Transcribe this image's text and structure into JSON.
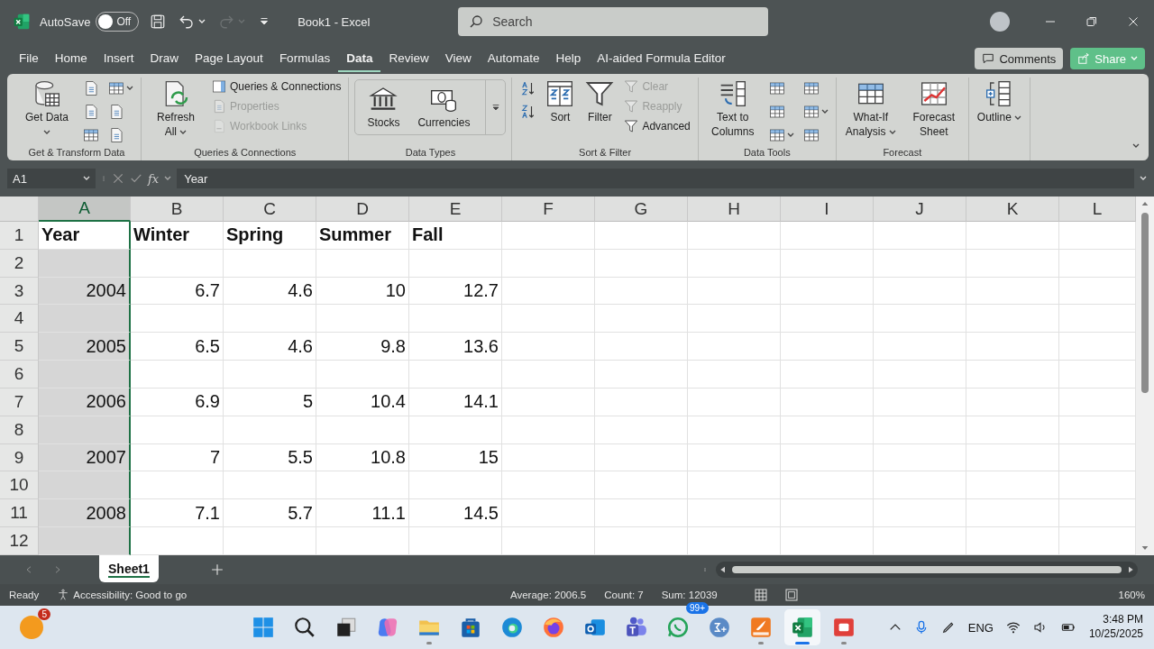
{
  "title_bar": {
    "autosave": {
      "label": "AutoSave",
      "state": "Off",
      "on": false
    },
    "document_title": "Book1  -  Excel",
    "search": {
      "placeholder": "Search"
    }
  },
  "menu_tabs": [
    {
      "label": "File",
      "selected": false
    },
    {
      "label": "Home",
      "selected": false
    },
    {
      "label": "Insert",
      "selected": false
    },
    {
      "label": "Draw",
      "selected": false
    },
    {
      "label": "Page Layout",
      "selected": false
    },
    {
      "label": "Formulas",
      "selected": false
    },
    {
      "label": "Data",
      "selected": true
    },
    {
      "label": "Review",
      "selected": false
    },
    {
      "label": "View",
      "selected": false
    },
    {
      "label": "Automate",
      "selected": false
    },
    {
      "label": "Help",
      "selected": false
    },
    {
      "label": "AI-aided Formula Editor",
      "selected": false
    }
  ],
  "comments_button": "Comments",
  "share_button": "Share",
  "ribbon": {
    "groups": [
      {
        "label": "Get & Transform Data",
        "columns": [
          {
            "kind": "stack",
            "items": [
              {
                "kind": "large",
                "label": "Get Data",
                "menu": true,
                "disabled": false
              }
            ]
          },
          {
            "kind": "stack",
            "items": [
              {
                "kind": "icon",
                "menu": false,
                "disabled": false
              },
              {
                "kind": "icon",
                "menu": false,
                "disabled": false
              },
              {
                "kind": "icon",
                "menu": false,
                "disabled": false
              }
            ]
          },
          {
            "kind": "stack",
            "items": [
              {
                "kind": "icon",
                "menu": true,
                "disabled": false
              },
              {
                "kind": "icon",
                "menu": false,
                "disabled": false
              },
              {
                "kind": "icon",
                "menu": false,
                "disabled": false
              }
            ]
          }
        ]
      },
      {
        "label": "Queries & Connections",
        "columns": [
          {
            "kind": "stack",
            "items": [
              {
                "kind": "large",
                "label": "Refresh All",
                "menu": true,
                "disabled": false
              }
            ]
          },
          {
            "kind": "stack",
            "items": [
              {
                "kind": "small",
                "label": "Queries & Connections",
                "menu": false,
                "disabled": false
              },
              {
                "kind": "small",
                "label": "Properties",
                "menu": false,
                "disabled": true
              },
              {
                "kind": "small",
                "label": "Workbook Links",
                "menu": false,
                "disabled": true
              }
            ]
          }
        ]
      },
      {
        "label": "Data Types",
        "columns": [
          {
            "kind": "gallery",
            "items": [
              {
                "kind": "large",
                "label": "Stocks",
                "menu": false,
                "disabled": false
              },
              {
                "kind": "large",
                "label": "Currencies",
                "menu": false,
                "disabled": false
              }
            ]
          }
        ]
      },
      {
        "label": "Sort & Filter",
        "columns": [
          {
            "kind": "stack",
            "items": [
              {
                "kind": "icon",
                "menu": false,
                "disabled": false
              },
              {
                "kind": "icon",
                "menu": false,
                "disabled": false
              }
            ]
          },
          {
            "kind": "stack",
            "items": [
              {
                "kind": "large",
                "label": "Sort",
                "menu": false,
                "disabled": false
              }
            ]
          },
          {
            "kind": "stack",
            "items": [
              {
                "kind": "large",
                "label": "Filter",
                "menu": false,
                "disabled": false
              }
            ]
          },
          {
            "kind": "stack",
            "items": [
              {
                "kind": "small",
                "label": "Clear",
                "menu": false,
                "disabled": true
              },
              {
                "kind": "small",
                "label": "Reapply",
                "menu": false,
                "disabled": true
              },
              {
                "kind": "small",
                "label": "Advanced",
                "menu": false,
                "disabled": false
              }
            ]
          }
        ]
      },
      {
        "label": "Data Tools",
        "columns": [
          {
            "kind": "stack",
            "items": [
              {
                "kind": "large",
                "label": "Text to Columns",
                "menu": false,
                "disabled": false
              }
            ]
          },
          {
            "kind": "stack",
            "items": [
              {
                "kind": "icon",
                "menu": false,
                "disabled": false
              },
              {
                "kind": "icon",
                "menu": false,
                "disabled": false
              },
              {
                "kind": "icon",
                "menu": true,
                "disabled": false
              }
            ]
          },
          {
            "kind": "stack",
            "items": [
              {
                "kind": "icon",
                "menu": false,
                "disabled": false
              },
              {
                "kind": "icon",
                "menu": true,
                "disabled": false
              },
              {
                "kind": "icon",
                "menu": false,
                "disabled": false
              }
            ]
          }
        ]
      },
      {
        "label": "Forecast",
        "columns": [
          {
            "kind": "stack",
            "items": [
              {
                "kind": "large",
                "label": "What-If Analysis",
                "menu": true,
                "disabled": false
              }
            ]
          },
          {
            "kind": "stack",
            "items": [
              {
                "kind": "large",
                "label": "Forecast Sheet",
                "menu": false,
                "disabled": false
              }
            ]
          }
        ]
      },
      {
        "columns": [
          {
            "kind": "stack",
            "items": [
              {
                "kind": "large",
                "label": "Outline",
                "menu": true,
                "disabled": false
              }
            ]
          }
        ]
      }
    ]
  },
  "formula_bar": {
    "name_box": "A1",
    "fx": "fx",
    "value": "Year"
  },
  "sheet": {
    "columns": [
      {
        "label": "A",
        "selected": true
      },
      {
        "label": "B",
        "selected": false
      },
      {
        "label": "C",
        "selected": false
      },
      {
        "label": "D",
        "selected": false
      },
      {
        "label": "E",
        "selected": false
      },
      {
        "label": "F",
        "selected": false
      },
      {
        "label": "G",
        "selected": false
      },
      {
        "label": "H",
        "selected": false
      },
      {
        "label": "I",
        "selected": false
      },
      {
        "label": "J",
        "selected": false
      },
      {
        "label": "K",
        "selected": false
      },
      {
        "label": "L",
        "selected": false
      }
    ],
    "rows": [
      {
        "number": "1",
        "kind": "header",
        "cells": [
          {
            "text": "Year",
            "active": true
          },
          {
            "text": "Winter",
            "active": false
          },
          {
            "text": "Spring",
            "active": false
          },
          {
            "text": "Summer",
            "active": false
          },
          {
            "text": "Fall",
            "active": false
          }
        ]
      },
      {
        "number": "2",
        "kind": "blank"
      },
      {
        "number": "3",
        "kind": "data",
        "cells": [
          {
            "text": "2004",
            "active": false
          },
          {
            "text": "6.7",
            "active": false
          },
          {
            "text": "4.6",
            "active": false
          },
          {
            "text": "10",
            "active": false
          },
          {
            "text": "12.7",
            "active": false
          }
        ]
      },
      {
        "number": "4",
        "kind": "blank"
      },
      {
        "number": "5",
        "kind": "data",
        "cells": [
          {
            "text": "2005",
            "active": false
          },
          {
            "text": "6.5",
            "active": false
          },
          {
            "text": "4.6",
            "active": false
          },
          {
            "text": "9.8",
            "active": false
          },
          {
            "text": "13.6",
            "active": false
          }
        ]
      },
      {
        "number": "6",
        "kind": "blank"
      },
      {
        "number": "7",
        "kind": "data",
        "cells": [
          {
            "text": "2006",
            "active": false
          },
          {
            "text": "6.9",
            "active": false
          },
          {
            "text": "5",
            "active": false
          },
          {
            "text": "10.4",
            "active": false
          },
          {
            "text": "14.1",
            "active": false
          }
        ]
      },
      {
        "number": "8",
        "kind": "blank"
      },
      {
        "number": "9",
        "kind": "data",
        "cells": [
          {
            "text": "2007",
            "active": false
          },
          {
            "text": "7",
            "active": false
          },
          {
            "text": "5.5",
            "active": false
          },
          {
            "text": "10.8",
            "active": false
          },
          {
            "text": "15",
            "active": false
          }
        ]
      },
      {
        "number": "10",
        "kind": "blank"
      },
      {
        "number": "11",
        "kind": "data",
        "cells": [
          {
            "text": "2008",
            "active": false
          },
          {
            "text": "7.1",
            "active": false
          },
          {
            "text": "5.7",
            "active": false
          },
          {
            "text": "11.1",
            "active": false
          },
          {
            "text": "14.5",
            "active": false
          }
        ]
      },
      {
        "number": "12",
        "kind": "blank"
      }
    ]
  },
  "sheet_tabs": [
    {
      "label": "Sheet1",
      "selected": true
    }
  ],
  "status_bar": {
    "mode": "Ready",
    "accessibility": "Accessibility: Good to go",
    "average": "Average: 2006.5",
    "count": "Count: 7",
    "sum": "Sum: 12039",
    "zoom": "160%"
  },
  "taskbar": {
    "notification_badge": "5",
    "apps": [
      {
        "running": false,
        "active": false
      },
      {
        "running": false,
        "active": false
      },
      {
        "running": false,
        "active": false
      },
      {
        "running": false,
        "active": false
      },
      {
        "running": true,
        "active": false
      },
      {
        "running": false,
        "active": false
      },
      {
        "running": false,
        "active": false
      },
      {
        "running": false,
        "active": false
      },
      {
        "running": false,
        "active": false
      },
      {
        "running": false,
        "active": false
      },
      {
        "running": false,
        "active": false,
        "badge": "99+"
      },
      {
        "running": false,
        "active": false
      },
      {
        "running": true,
        "active": false
      },
      {
        "running": true,
        "active": true
      },
      {
        "running": true,
        "active": false
      }
    ],
    "language": "ENG",
    "time": "3:48 PM",
    "date": "10/25/2025"
  }
}
